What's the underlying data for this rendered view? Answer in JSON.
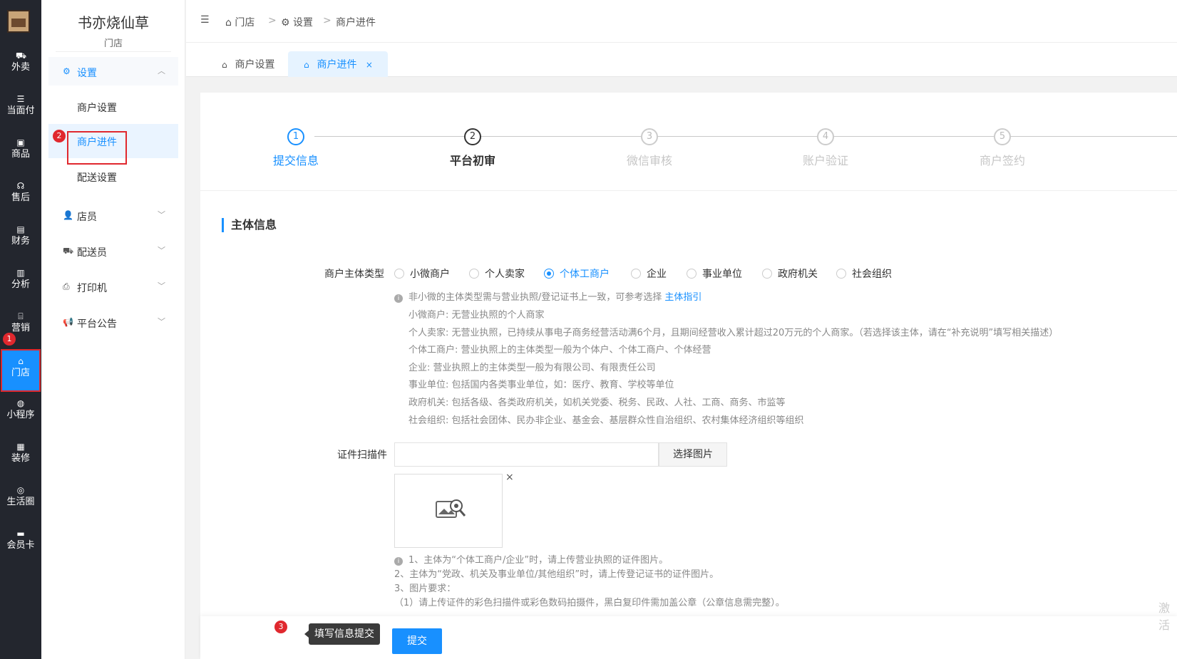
{
  "rail": {
    "items": [
      {
        "label": "外卖",
        "icon": "truck-icon"
      },
      {
        "label": "当面付",
        "icon": "list-icon"
      },
      {
        "label": "商品",
        "icon": "box-icon"
      },
      {
        "label": "售后",
        "icon": "headset-icon"
      },
      {
        "label": "财务",
        "icon": "wallet-icon"
      },
      {
        "label": "分析",
        "icon": "bar-chart-icon"
      },
      {
        "label": "营销",
        "icon": "gift-icon"
      },
      {
        "label": "门店",
        "icon": "store-icon"
      },
      {
        "label": "小程序",
        "icon": "wechat-icon"
      },
      {
        "label": "装修",
        "icon": "bag-icon"
      },
      {
        "label": "生活圈",
        "icon": "lifebuoy-icon"
      },
      {
        "label": "会员卡",
        "icon": "card-icon"
      }
    ],
    "active_index": 7,
    "badge_1": "1"
  },
  "sidebar": {
    "title": "书亦烧仙草",
    "subtitle": "门店",
    "settings_group": "设置",
    "settings_items": [
      "商户设置",
      "商户进件",
      "配送设置"
    ],
    "badge_2": "2",
    "groups": [
      "店员",
      "配送员",
      "打印机",
      "平台公告"
    ]
  },
  "breadcrumb": [
    "门店",
    "设置",
    "商户进件"
  ],
  "tabs": [
    {
      "label": "商户设置"
    },
    {
      "label": "商户进件",
      "close": "×"
    }
  ],
  "steps": [
    {
      "num": "1",
      "label": "提交信息"
    },
    {
      "num": "2",
      "label": "平台初审"
    },
    {
      "num": "3",
      "label": "微信审核"
    },
    {
      "num": "4",
      "label": "账户验证"
    },
    {
      "num": "5",
      "label": "商户签约"
    }
  ],
  "form": {
    "section_title": "主体信息",
    "type_label": "商户主体类型",
    "type_options": [
      "小微商户",
      "个人卖家",
      "个体工商户",
      "企业",
      "事业单位",
      "政府机关",
      "社会组织"
    ],
    "type_selected": "个体工商户",
    "hint_main": "非小微的主体类型需与营业执照/登记证书上一致，可参考选择",
    "hint_link": "主体指引",
    "hints": [
      "小微商户: 无营业执照的个人商家",
      "个人卖家: 无营业执照，已持续从事电子商务经营活动满6个月，且期间经营收入累计超过20万元的个人商家。（若选择该主体，请在“补充说明”填写相关描述）",
      "个体工商户: 营业执照上的主体类型一般为个体户、个体工商户、个体经营",
      "企业: 营业执照上的主体类型一般为有限公司、有限责任公司",
      "事业单位: 包括国内各类事业单位，如：医疗、教育、学校等单位",
      "政府机关: 包括各级、各类政府机关，如机关党委、税务、民政、人社、工商、商务、市监等",
      "社会组织: 包括社会团体、民办非企业、基金会、基层群众性自治组织、农村集体经济组织等组织"
    ],
    "cert_label": "证件扫描件",
    "cert_value": "",
    "choose_btn": "选择图片",
    "preview_close": "×",
    "notes": [
      "1、主体为“个体工商户/企业”时，请上传营业执照的证件图片。",
      "2、主体为“党政、机关及事业单位/其他组织”时，请上传登记证书的证件图片。",
      "3、图片要求：",
      "（1）请上传证件的彩色扫描件或彩色数码拍摄件，黑白复印件需加盖公章（公章信息需完整）。"
    ]
  },
  "bottom": {
    "badge_3": "3",
    "tooltip": "填写信息提交",
    "submit": "提交"
  },
  "watermark": "激活"
}
